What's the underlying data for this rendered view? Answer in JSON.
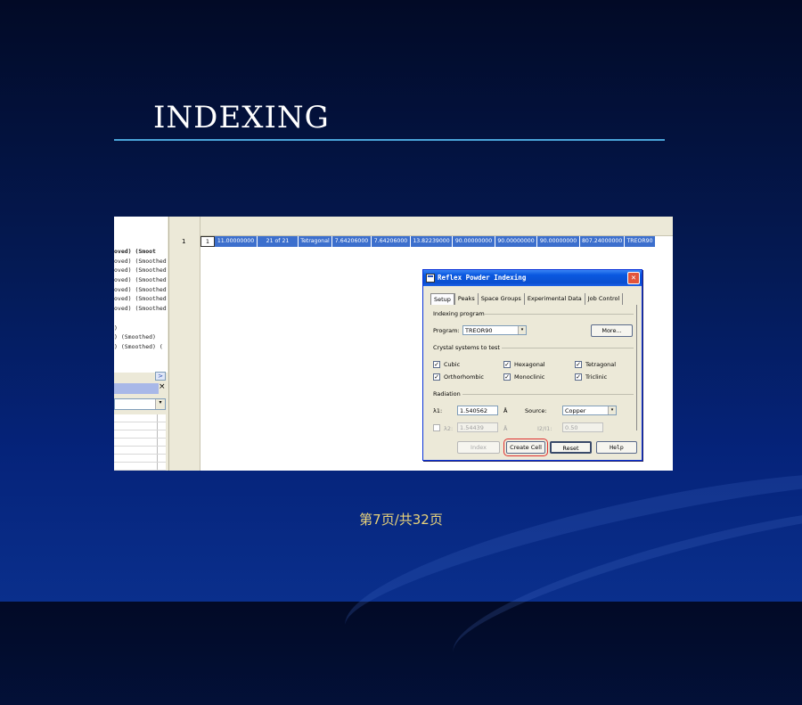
{
  "slide": {
    "title": "INDEXING",
    "page_number": "第7页/共32页"
  },
  "left_panel": {
    "lines": [
      {
        "text": "oved) (Smoot",
        "bold": true
      },
      {
        "text": "oved) (Smoothed"
      },
      {
        "text": "oved) (Smoothed"
      },
      {
        "text": "oved) (Smoothed"
      },
      {
        "text": "oved) (Smoothed"
      },
      {
        "text": "oved) (Smoothed"
      },
      {
        "text": "oved) (Smoothed"
      },
      {
        "text": ""
      },
      {
        "text": ")"
      },
      {
        "text": ") (Smoothed)"
      },
      {
        "text": ") (Smoothed) ("
      }
    ],
    "scroll_arrow": ">",
    "close_glyph": "×",
    "combo_arrow": "▾"
  },
  "results_table": {
    "row_number": "1",
    "cells": [
      "1",
      "11.00000000",
      "21 of 21",
      "Tetragonal",
      "7.64206000",
      "7.64206000",
      "13.82239000",
      "90.00000000",
      "90.00000000",
      "90.00000000",
      "807.24000000",
      "TREOR90"
    ]
  },
  "dialog": {
    "title": "Reflex Powder Indexing",
    "close_glyph": "✕",
    "tabs": [
      "Setup",
      "Peaks",
      "Space Groups",
      "Experimental Data",
      "Job Control"
    ],
    "active_tab": "Setup",
    "indexing_program_group": "Indexing program",
    "program_label": "Program:",
    "program_value": "TREOR90",
    "more_button": "More...",
    "crystal_group": "Crystal systems to test",
    "crystal_systems": [
      {
        "label": "Cubic",
        "checked": true
      },
      {
        "label": "Hexagonal",
        "checked": true
      },
      {
        "label": "Tetragonal",
        "checked": true
      },
      {
        "label": "Orthorhombic",
        "checked": true
      },
      {
        "label": "Monoclinic",
        "checked": true
      },
      {
        "label": "Triclinic",
        "checked": true
      }
    ],
    "radiation_group": "Radiation",
    "lambda1_label": "λ1:",
    "lambda1_value": "1.540562",
    "lambda1_unit": "Å",
    "source_label": "Source:",
    "source_value": "Copper",
    "lambda2_checked": false,
    "lambda2_label": "λ2:",
    "lambda2_value": "1.54439",
    "lambda2_unit": "Å",
    "ratio_label": "I2/I1:",
    "ratio_value": "0.50",
    "buttons": {
      "index": "Index",
      "create_cell": "Create Cell",
      "reset": "Reset",
      "help": "Help"
    },
    "check_glyph": "✓",
    "combo_arrow": "▾"
  }
}
